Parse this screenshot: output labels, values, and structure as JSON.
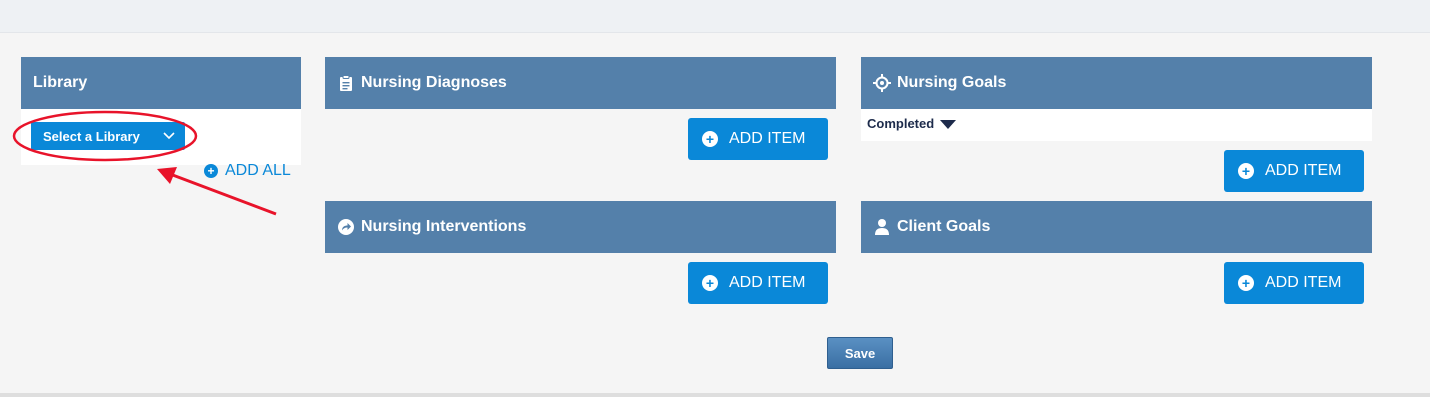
{
  "library": {
    "title": "Library",
    "select_label": "Select a Library",
    "add_all_label": "ADD ALL"
  },
  "panels": {
    "nursing_diagnoses": {
      "title": "Nursing Diagnoses",
      "icon": "clipboard-icon",
      "add_label": "ADD ITEM"
    },
    "nursing_goals": {
      "title": "Nursing Goals",
      "icon": "target-icon",
      "status_label": "Completed",
      "add_label": "ADD ITEM"
    },
    "nursing_interventions": {
      "title": "Nursing Interventions",
      "icon": "share-arrow-icon",
      "add_label": "ADD ITEM"
    },
    "client_goals": {
      "title": "Client Goals",
      "icon": "user-icon",
      "add_label": "ADD ITEM"
    }
  },
  "save_label": "Save",
  "colors": {
    "header": "#5480aa",
    "accent": "#0a88d8",
    "annotation": "#e8132a"
  }
}
